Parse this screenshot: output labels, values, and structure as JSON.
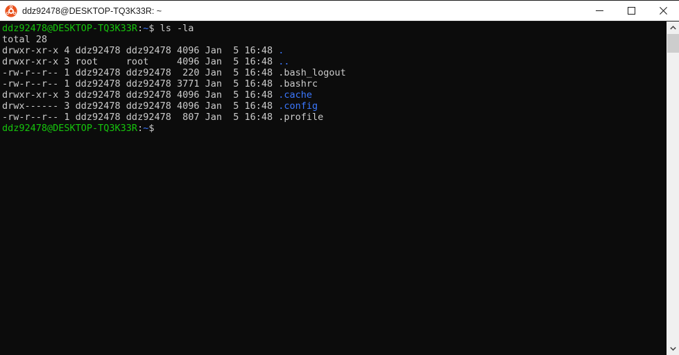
{
  "window": {
    "title": "ddz92478@DESKTOP-TQ3K33R: ~",
    "icon": "ubuntu-logo-icon",
    "controls": {
      "minimize": "minimize-button",
      "maximize": "maximize-button",
      "close": "close-button"
    }
  },
  "theme": {
    "background": "#0c0c0c",
    "foreground": "#cccccc",
    "green": "#16c60c",
    "blue": "#3b78ff",
    "titlebar_bg": "#ffffff",
    "titlebar_fg": "#1a1a1a",
    "scrollbar_track": "#f0f0f0",
    "scrollbar_thumb": "#cdcdcd"
  },
  "terminal": {
    "prompt": {
      "user_host": "ddz92478@DESKTOP-TQ3K33R",
      "colon": ":",
      "path": "~",
      "symbol": "$"
    },
    "command": " ls -la",
    "total_line": "total 28",
    "listing": [
      {
        "perms": "drwxr-xr-x",
        "links": "4",
        "owner": "ddz92478",
        "group": "ddz92478",
        "size": "4096",
        "month": "Jan",
        "day": "5",
        "time": "16:48",
        "name": ".",
        "name_color": "blue",
        "raw": "drwxr-xr-x 4 ddz92478 ddz92478 4096 Jan  5 16:48 "
      },
      {
        "perms": "drwxr-xr-x",
        "links": "3",
        "owner": "root",
        "group": "root",
        "size": "4096",
        "month": "Jan",
        "day": "5",
        "time": "16:48",
        "name": "..",
        "name_color": "blue",
        "raw": "drwxr-xr-x 3 root     root     4096 Jan  5 16:48 "
      },
      {
        "perms": "-rw-r--r--",
        "links": "1",
        "owner": "ddz92478",
        "group": "ddz92478",
        "size": "220",
        "month": "Jan",
        "day": "5",
        "time": "16:48",
        "name": ".bash_logout",
        "name_color": "white",
        "raw": "-rw-r--r-- 1 ddz92478 ddz92478  220 Jan  5 16:48 "
      },
      {
        "perms": "-rw-r--r--",
        "links": "1",
        "owner": "ddz92478",
        "group": "ddz92478",
        "size": "3771",
        "month": "Jan",
        "day": "5",
        "time": "16:48",
        "name": ".bashrc",
        "name_color": "white",
        "raw": "-rw-r--r-- 1 ddz92478 ddz92478 3771 Jan  5 16:48 "
      },
      {
        "perms": "drwxr-xr-x",
        "links": "3",
        "owner": "ddz92478",
        "group": "ddz92478",
        "size": "4096",
        "month": "Jan",
        "day": "5",
        "time": "16:48",
        "name": ".cache",
        "name_color": "blue",
        "raw": "drwxr-xr-x 3 ddz92478 ddz92478 4096 Jan  5 16:48 "
      },
      {
        "perms": "drwx------",
        "links": "3",
        "owner": "ddz92478",
        "group": "ddz92478",
        "size": "4096",
        "month": "Jan",
        "day": "5",
        "time": "16:48",
        "name": ".config",
        "name_color": "blue",
        "raw": "drwx------ 3 ddz92478 ddz92478 4096 Jan  5 16:48 "
      },
      {
        "perms": "-rw-r--r--",
        "links": "1",
        "owner": "ddz92478",
        "group": "ddz92478",
        "size": "807",
        "month": "Jan",
        "day": "5",
        "time": "16:48",
        "name": ".profile",
        "name_color": "white",
        "raw": "-rw-r--r-- 1 ddz92478 ddz92478  807 Jan  5 16:48 "
      }
    ]
  },
  "scrollbar": {
    "up_arrow": "scroll-up-icon",
    "down_arrow": "scroll-down-icon"
  }
}
